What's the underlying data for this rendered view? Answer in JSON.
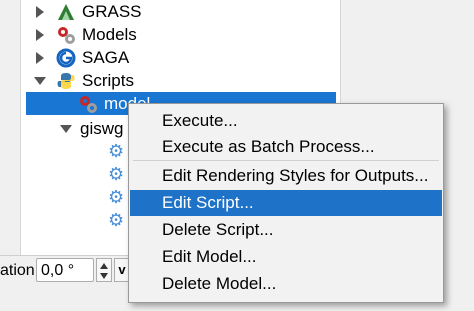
{
  "tree": {
    "items": [
      {
        "label": "GRASS",
        "icon": "grass-icon"
      },
      {
        "label": "Models",
        "icon": "models-gear-icon"
      },
      {
        "label": "SAGA",
        "icon": "saga-icon"
      },
      {
        "label": "Scripts",
        "icon": "python-icon"
      },
      {
        "label": "model",
        "icon": "script-gear-icon"
      },
      {
        "label": "giswg",
        "icon": ""
      }
    ]
  },
  "bottom": {
    "rotation_label": "ation",
    "rotation_value": "0,0 °"
  },
  "context_menu": {
    "items": [
      {
        "label": "Execute..."
      },
      {
        "label": "Execute as Batch Process..."
      },
      {
        "label": "Edit Rendering Styles for Outputs..."
      },
      {
        "label": "Edit Script..."
      },
      {
        "label": "Delete Script..."
      },
      {
        "label": "Edit Model..."
      },
      {
        "label": "Delete Model..."
      }
    ],
    "highlighted_index": 3
  },
  "colors": {
    "selection": "#1976d2",
    "menu_highlight": "#1e73c9"
  }
}
